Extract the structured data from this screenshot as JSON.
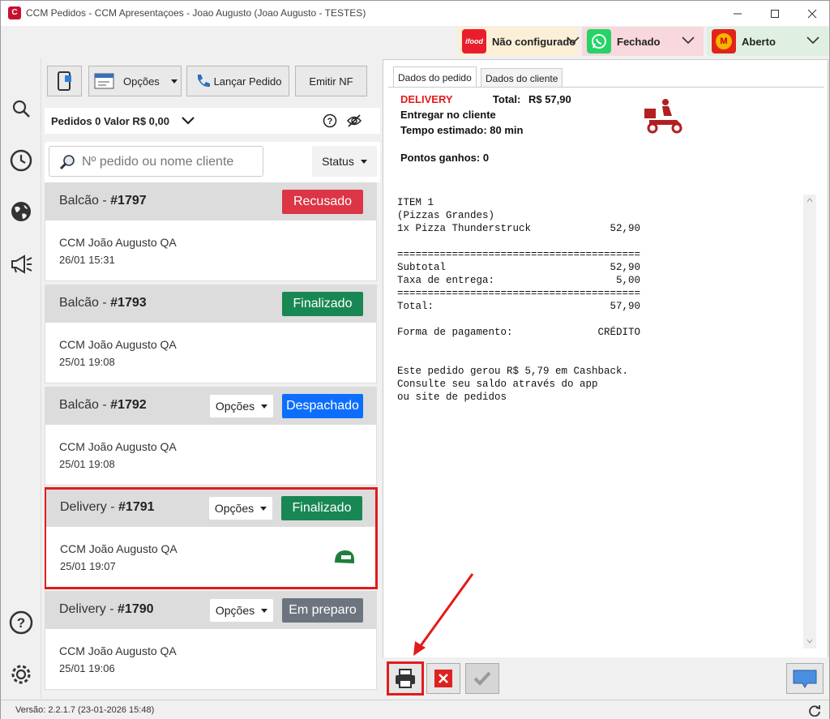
{
  "window": {
    "title": "CCM Pedidos - CCM Apresentaçoes - Joao Augusto (Joao Augusto - TESTES)",
    "app_icon_letter": "C"
  },
  "integrations": [
    {
      "logo_text": "ifood",
      "label": "Não configurado",
      "bg": "#fcefd8",
      "logo_color": "#ea1d2c"
    },
    {
      "logo_text": "",
      "label": "Fechado",
      "bg": "#f8d8dc",
      "logo_color": "#25d366"
    },
    {
      "logo_text": "M",
      "label": "Aberto",
      "bg": "#dff0e3",
      "logo_color": "#e2231a"
    }
  ],
  "toolbar": {
    "options_label": "Opções",
    "launch_label": "Lançar Pedido",
    "nf_label": "Emitir NF"
  },
  "summary": {
    "text": "Pedidos 0 Valor R$ 0,00"
  },
  "search": {
    "placeholder": "Nº pedido ou nome cliente",
    "status_label": "Status"
  },
  "orders": [
    {
      "type": "Balcão",
      "number": "#1797",
      "status": "Recusado",
      "status_color": "#dc3545",
      "customer": "CCM João Augusto QA",
      "datetime": "26/01 15:31",
      "has_options": false
    },
    {
      "type": "Balcão",
      "number": "#1793",
      "status": "Finalizado",
      "status_color": "#198754",
      "customer": "CCM João Augusto QA",
      "datetime": "25/01 19:08",
      "has_options": false
    },
    {
      "type": "Balcão",
      "number": "#1792",
      "status": "Despachado",
      "status_color": "#0d6efd",
      "customer": "CCM João Augusto QA",
      "datetime": "25/01 19:08",
      "has_options": true
    },
    {
      "type": "Delivery",
      "number": "#1791",
      "status": "Finalizado",
      "status_color": "#198754",
      "customer": "CCM João Augusto QA",
      "datetime": "25/01 19:07",
      "has_options": true
    },
    {
      "type": "Delivery",
      "number": "#1790",
      "status": "Em preparo",
      "status_color": "#6c757d",
      "customer": "CCM João Augusto QA",
      "datetime": "25/01 19:06",
      "has_options": true
    }
  ],
  "options_label": "Opções",
  "detail": {
    "tabs": [
      "Dados do pedido",
      "Dados do cliente"
    ],
    "mode": "DELIVERY",
    "total_label": "Total:",
    "total_value": "R$ 57,90",
    "line1": "Entregar no cliente",
    "line2": "Tempo estimado: 80 min",
    "points": "Pontos ganhos: 0",
    "receipt": "ITEM 1\n(Pizzas Grandes)\n1x Pizza Thunderstruck             52,90\n\n========================================\nSubtotal                           52,90\nTaxa de entrega:                    5,00\n========================================\nTotal:                             57,90\n\nForma de pagamento:              CRÉDITO\n\n\nEste pedido gerou R$ 5,79 em Cashback.\nConsulte seu saldo através do app\nou site de pedidos"
  },
  "footer": {
    "version": "Versão: 2.2.1.7 (23-01-2026 15:48)"
  },
  "colors": {
    "highlight": "#e21b1b"
  }
}
